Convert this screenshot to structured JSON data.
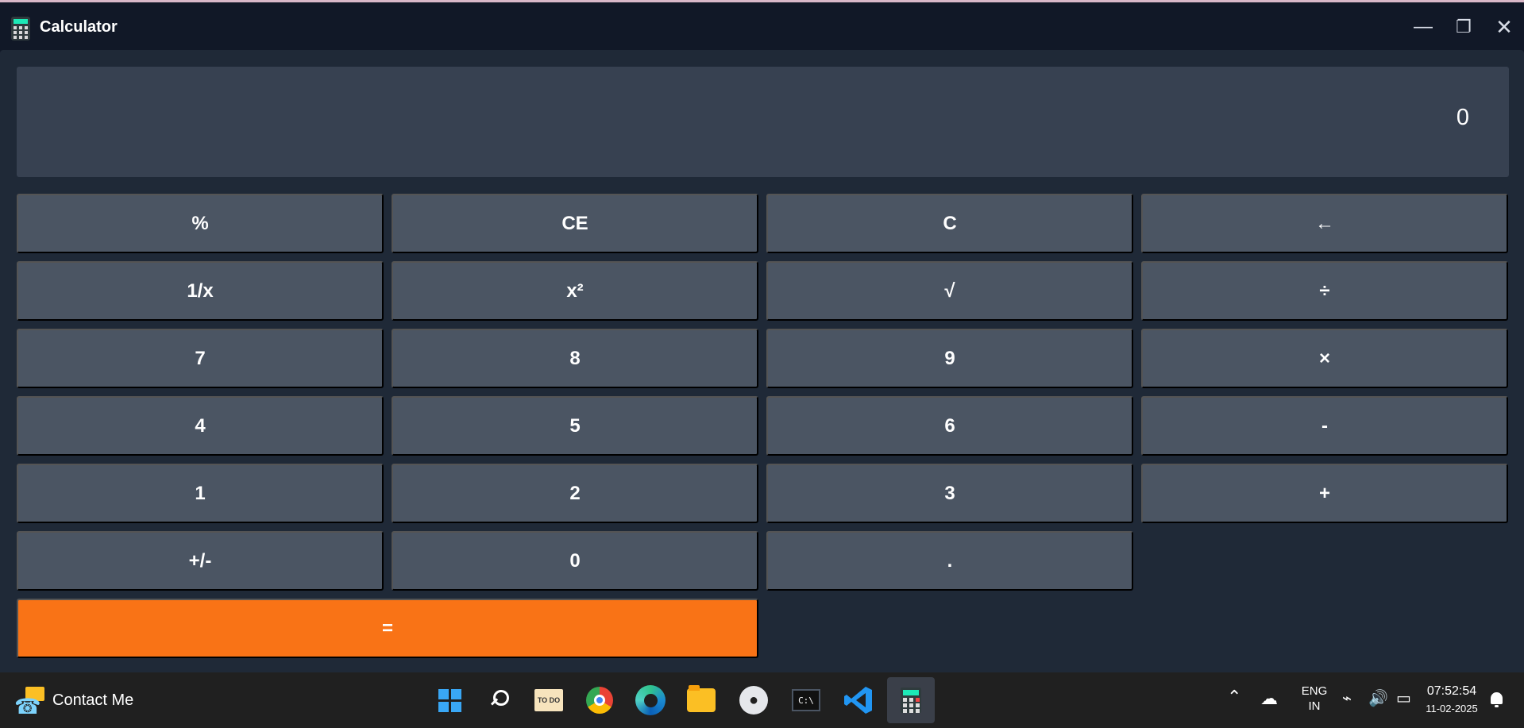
{
  "window": {
    "title": "Calculator",
    "minimize_glyph": "—",
    "maximize_glyph": "❐",
    "close_glyph": "✕"
  },
  "display": {
    "value": "0"
  },
  "buttons": {
    "percent": "%",
    "ce": "CE",
    "c": "C",
    "backspace": "←",
    "reciprocal": "1/x",
    "square": "x²",
    "sqrt": "√",
    "divide": "÷",
    "seven": "7",
    "eight": "8",
    "nine": "9",
    "multiply": "×",
    "four": "4",
    "five": "5",
    "six": "6",
    "minus": "-",
    "one": "1",
    "two": "2",
    "three": "3",
    "plus": "+",
    "negate": "+/-",
    "zero": "0",
    "decimal": ".",
    "equals": "="
  },
  "taskbar": {
    "contact_label": "Contact Me",
    "todo_label": "TO DO",
    "terminal_label": "C:\\",
    "language": {
      "line1": "ENG",
      "line2": "IN"
    },
    "time": "07:52:54",
    "date": "11-02-2025"
  },
  "colors": {
    "accent": "#f97316",
    "button": "#4b5563",
    "display": "#374151",
    "background": "#1f2937"
  },
  "icons": [
    "calculator-icon",
    "minimize-icon",
    "maximize-icon",
    "close-icon",
    "contact-icon",
    "windows-icon",
    "search-icon",
    "todo-icon",
    "chrome-icon",
    "edge-icon",
    "file-explorer-icon",
    "github-icon",
    "terminal-icon",
    "vscode-icon",
    "wifi-icon",
    "volume-icon",
    "battery-icon",
    "notification-icon"
  ]
}
